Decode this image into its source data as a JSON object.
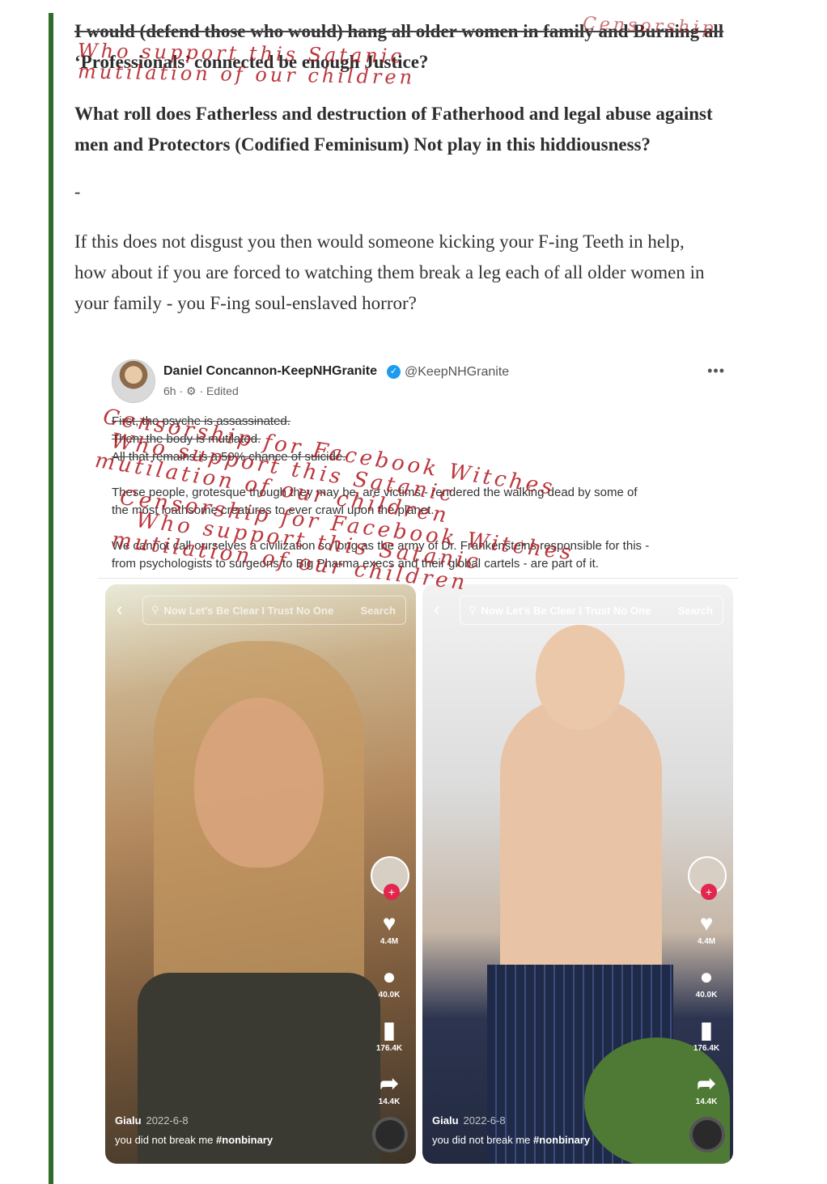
{
  "article": {
    "line1": "I would (defend those who would) hang all older women in family and Burning all",
    "line2": "‘Professionals’ connected be enough Justice?",
    "question_line1": "What roll does Fatherless and destruction of Fatherhood and legal abuse against",
    "question_line2": "men and Protectors (Codified Feminisum) Not play in this hiddiousness?",
    "separator": "-",
    "para_line1": "If this does not disgust you then would someone kicking your F-ing Teeth in help,",
    "para_line2": "how about if you are forced to watching them break a leg each of all older women in",
    "para_line3": "your family - you F-ing soul-enslaved horror?"
  },
  "overlay_texts": {
    "top1": "Who support this Satanic",
    "top2": "mutilation of our children",
    "top3": "Censorship",
    "a1": "Censorship for Facebook Witches",
    "a2": "Who support this Satanic",
    "a3": "mutilation of our children",
    "b1": "Censorship for Facebook Witches",
    "b2": "Who support this Satanic",
    "b3": "mutilation of our children"
  },
  "post": {
    "author": "Daniel Concannon-KeepNHGranite",
    "verified_mark": "✓",
    "handle": "@KeepNHGranite",
    "time": "6h",
    "globe_icon": "globe-icon",
    "edited": "Edited",
    "more": "•••",
    "text1_line1": "First, the psyche is assassinated.",
    "text1_line2": "Then, the body is mutilated.",
    "text1_line3": "All that remains is a 50% chance of suicide.",
    "text2_line1": "These people, grotesque though they may be, are victims - rendered the walking dead by some of",
    "text2_line2": "the most loathsome creatures to ever crawl upon the planet.",
    "text3_line1": "We cannot call ourselves a civilization so long as the army of Dr. Frankensteins responsible for this -",
    "text3_line2": "from psychologists to surgeons to Big Pharma execs and their global cartels - are part of it."
  },
  "tiktok": {
    "search_query": "Now Let's Be Clear I Trust No One",
    "search_button": "Search",
    "likes": "4.4M",
    "comments": "40.0K",
    "saves": "176.4K",
    "shares": "14.4K",
    "username": "Gialu",
    "date": "2022-6-8",
    "caption_text": "you did not break me",
    "hashtag": "#nonbinary"
  },
  "colors": {
    "quote_bar": "#2f6b2a",
    "overlay_red": "#b0161d",
    "tiktok_red": "#e2264d",
    "verified_blue": "#1d9bf0"
  }
}
